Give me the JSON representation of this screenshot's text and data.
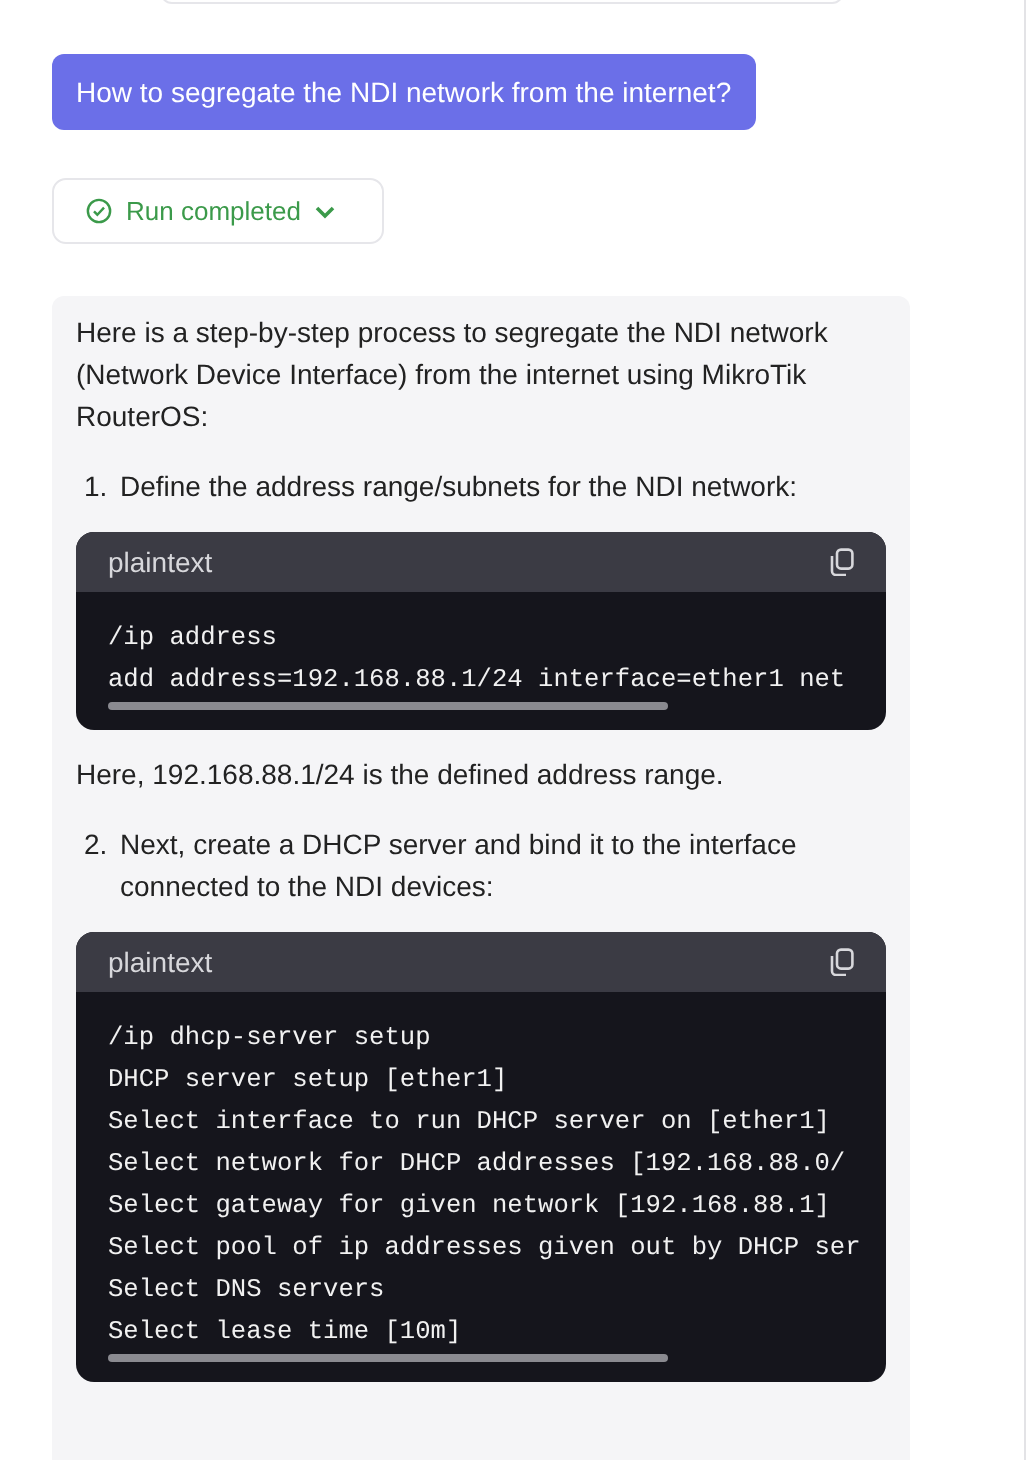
{
  "user_message": "How to segregate the NDI network from the internet?",
  "run_status": {
    "label": "Run completed",
    "expanded": false
  },
  "answer": [
    {
      "kind": "paragraph",
      "text": "Here is a step-by-step process to segregate the NDI network (Network Device Interface) from the internet using MikroTik RouterOS:"
    },
    {
      "kind": "step",
      "number": "1.",
      "text": "Define the address range/subnets for the NDI network:"
    },
    {
      "kind": "code",
      "language": "plaintext",
      "lines": [
        "/ip address",
        "add address=192.168.88.1/24 interface=ether1 net"
      ]
    },
    {
      "kind": "paragraph",
      "text": "Here, 192.168.88.1/24 is the defined address range."
    },
    {
      "kind": "step",
      "number": "2.",
      "text": "Next, create a DHCP server and bind it to the interface connected to the NDI devices:"
    },
    {
      "kind": "code",
      "language": "plaintext",
      "lines": [
        "/ip dhcp-server setup",
        "DHCP server setup [ether1]",
        "Select interface to run DHCP server on [ether1]",
        "Select network for DHCP addresses [192.168.88.0/",
        "Select gateway for given network [192.168.88.1]",
        "Select pool of ip addresses given out by DHCP ser",
        "Select DNS servers",
        "Select lease time [10m]"
      ]
    }
  ]
}
